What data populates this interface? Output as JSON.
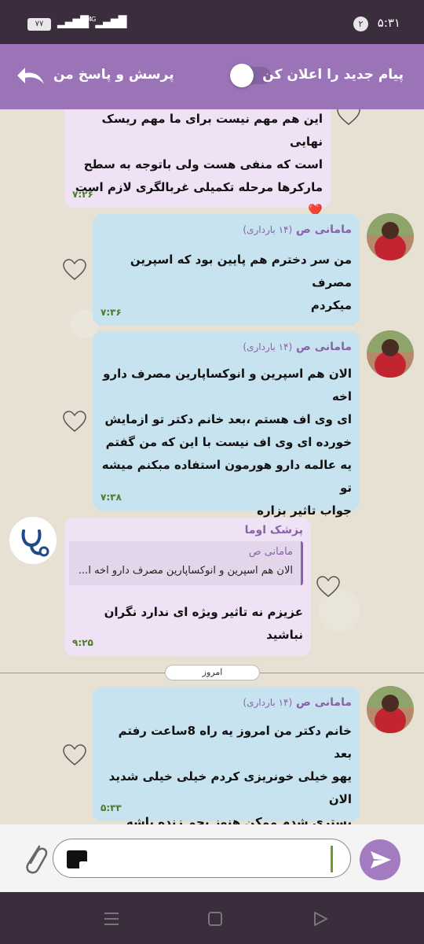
{
  "status_bar": {
    "time": "۵:۳۱",
    "notification_count": "۲",
    "battery": "۷۷",
    "network": "4G"
  },
  "header": {
    "title": "پرسش و پاسخ من",
    "notify_label": "پیام جدید را اعلان کن",
    "notify_enabled": false
  },
  "messages": [
    {
      "lines": [
        "این هم مهم نیست برای ما مهم ریسک نهایی",
        "است که منفی هست ولی باتوجه به سطح",
        "مارکرها مرحله تکمیلی غربالگری لازم است ❤️"
      ],
      "time": "۷:۲۶"
    },
    {
      "sender": "مامانی ص",
      "sender_note": "(۱۴ بارداری)",
      "lines": [
        "من سر دخترم هم پایین بود که اسپرین مصرف",
        "میکردم"
      ],
      "time": "۷:۳۶"
    },
    {
      "sender": "مامانی ص",
      "sender_note": "(۱۴ بارداری)",
      "lines": [
        "الان هم اسپرین و انوکساپارین مصرف دارو اخه",
        "ای وی اف هستم ،بعد خانم دکتر تو ازمایش",
        "خورده ای وی اف نیست با این که من گفتم",
        "یه عالمه دارو هورمون استفاده مبکنم میشه تو",
        "جواب تاثیر بزاره"
      ],
      "time": "۷:۳۸"
    },
    {
      "sender": "پزشک اوما",
      "reply_name": "مامانی ص",
      "reply_text": "الان هم اسپرین و انوکساپارین مصرف دارو اخه ا...",
      "lines": [
        "عزیزم نه تاثیر ویژه ای ندارد نگران نباشید"
      ],
      "time": "۹:۲۵"
    },
    {
      "sender": "مامانی ص",
      "sender_note": "(۱۴ بارداری)",
      "lines": [
        "خانم دکتر من امروز یه راه 8ساعت رفتم بعد",
        "یهو خیلی خونریزی کردم خیلی خیلی شدید الان",
        "بستری شدم ممکن هنوز بچم زنده باشه"
      ],
      "time": "۵:۳۳"
    }
  ],
  "date_divider": "امروز",
  "composer": {
    "value": ""
  },
  "colors": {
    "header": "#9b73b7",
    "status_bar": "#3b2d3e",
    "bubble_user": "#c7e3ef",
    "bubble_doctor": "#efe2f4",
    "accent": "#8a61a8"
  },
  "icons": {
    "back": "undo-arrow-icon",
    "attach": "paperclip-icon",
    "emoji": "sticker-icon",
    "send": "send-icon",
    "like": "heart-outline-icon",
    "doctor_logo": "stethoscope-icon",
    "nav_menu": "recents-icon",
    "nav_home": "home-icon",
    "nav_back": "back-triangle-icon"
  }
}
